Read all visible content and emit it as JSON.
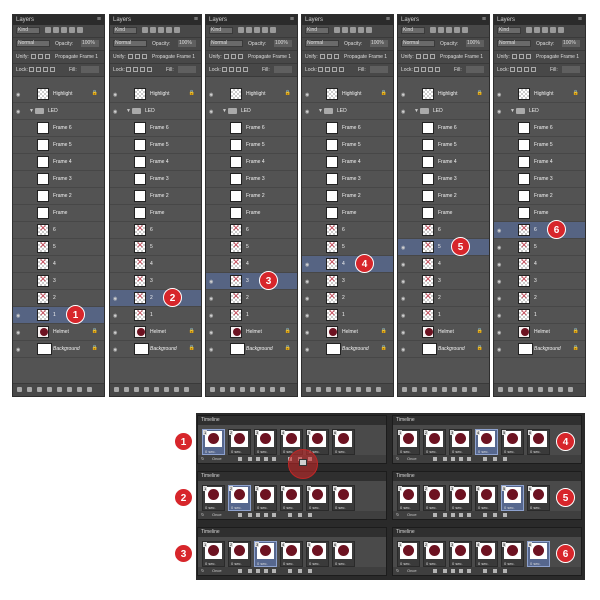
{
  "layers_panel": {
    "title": "Layers",
    "filter_kind": "Kind",
    "blend_mode": "Normal",
    "opacity_label": "Opacity:",
    "opacity_value": "100%",
    "unify_label": "Unify:",
    "propagate_label": "Propagate Frame 1",
    "lock_label": "Lock:",
    "fill_label": "Fill:",
    "fill_value": "100%"
  },
  "layer_names": {
    "highlight": "Highlight",
    "led": "LED",
    "frame6": "Frame 6",
    "frame5": "Frame 5",
    "frame4": "Frame 4",
    "frame3": "Frame 3",
    "frame2": "Frame 2",
    "frame": "Frame",
    "l6": "6",
    "l5": "5",
    "l4": "4",
    "l3": "3",
    "l2": "2",
    "l1": "1",
    "helmet": "Helmet",
    "background": "Background"
  },
  "panels": [
    {
      "badge": "1",
      "selected": "1",
      "hidden": [
        "2",
        "3",
        "4",
        "5",
        "6",
        "frame",
        "frame2",
        "frame3",
        "frame4",
        "frame5",
        "frame6"
      ]
    },
    {
      "badge": "2",
      "selected": "2",
      "hidden": [
        "3",
        "4",
        "5",
        "6",
        "frame",
        "frame2",
        "frame3",
        "frame4",
        "frame5",
        "frame6"
      ]
    },
    {
      "badge": "3",
      "selected": "3",
      "hidden": [
        "4",
        "5",
        "6",
        "frame",
        "frame2",
        "frame3",
        "frame4",
        "frame5",
        "frame6"
      ]
    },
    {
      "badge": "4",
      "selected": "4",
      "hidden": [
        "5",
        "6",
        "frame",
        "frame2",
        "frame3",
        "frame4",
        "frame5",
        "frame6"
      ]
    },
    {
      "badge": "5",
      "selected": "5",
      "hidden": [
        "6",
        "frame",
        "frame2",
        "frame3",
        "frame4",
        "frame5",
        "frame6"
      ]
    },
    {
      "badge": "6",
      "selected": "6",
      "hidden": [
        "frame",
        "frame2",
        "frame3",
        "frame4",
        "frame5",
        "frame6"
      ]
    }
  ],
  "timeline": {
    "title": "Timeline",
    "frame_duration": "0 sec.",
    "loop_option": "Once",
    "panels": [
      {
        "badge": "1",
        "selected_frames": [
          1
        ]
      },
      {
        "badge": "2",
        "selected_frames": [
          2
        ]
      },
      {
        "badge": "3",
        "selected_frames": [
          3
        ]
      },
      {
        "badge": "4",
        "selected_frames": [
          4
        ]
      },
      {
        "badge": "5",
        "selected_frames": [
          5
        ]
      },
      {
        "badge": "6",
        "selected_frames": [
          6
        ]
      }
    ],
    "frames_per_panel": 6
  },
  "colors": {
    "badge_red": "#d7262b",
    "selection_blue": "#566483",
    "panel_gray": "#535353"
  }
}
